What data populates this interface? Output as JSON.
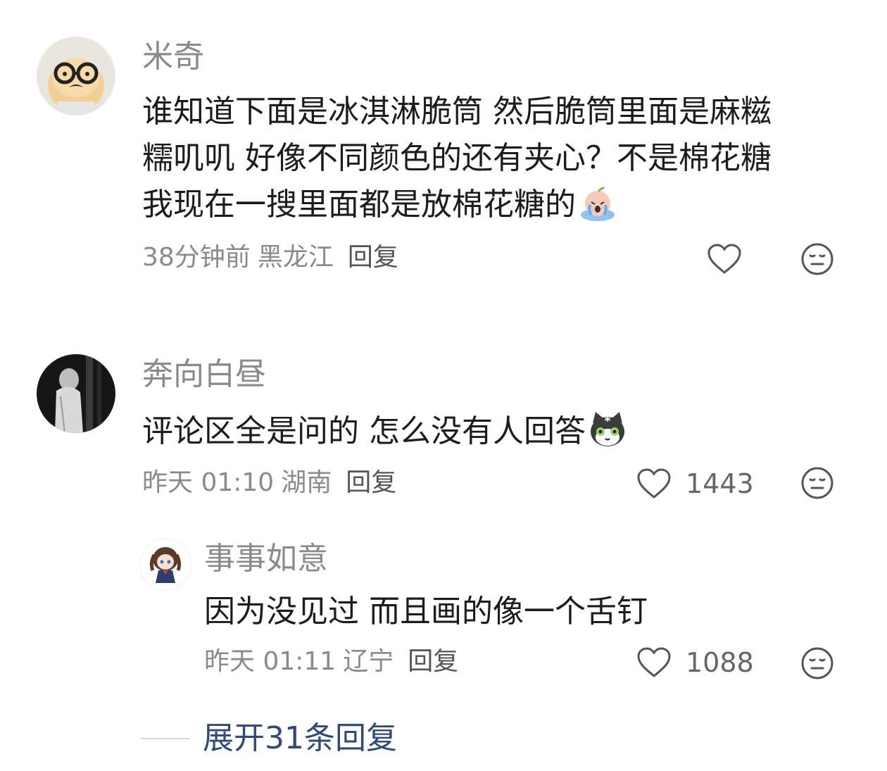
{
  "comments": [
    {
      "username": "米奇",
      "content_lines": [
        "谁知道下面是冰淇淋脆筒 然后脆筒里面是麻糍",
        "糯叽叽 好像不同颜色的还有夹心？不是棉花糖",
        "我现在一搜里面都是放棉花糖的"
      ],
      "content_emoji": "crying-peach-emoji",
      "time": "38分钟前",
      "location": "黑龙江",
      "reply_label": "回复",
      "likes": "",
      "avatar_icon": "dog-with-glasses-avatar"
    },
    {
      "username": "奔向白昼",
      "content_lines": [
        "评论区全是问的 怎么没有人回答"
      ],
      "content_emoji": "shocked-cat-emoji",
      "time": "昨天 01:10",
      "location": "湖南",
      "reply_label": "回复",
      "likes": "1443",
      "avatar_icon": "dark-figure-avatar",
      "replies": [
        {
          "username": "事事如意",
          "content_lines": [
            "因为没见过 而且画的像一个舌钉"
          ],
          "time": "昨天 01:11",
          "location": "辽宁",
          "reply_label": "回复",
          "likes": "1088",
          "avatar_icon": "anime-girl-avatar"
        }
      ]
    }
  ],
  "expand_replies_label": "展开31条回复",
  "colors": {
    "username": "#8a8a8a",
    "content": "#1c1c1c",
    "meta": "#8a8a8a",
    "expand_link": "#2d4a78"
  }
}
